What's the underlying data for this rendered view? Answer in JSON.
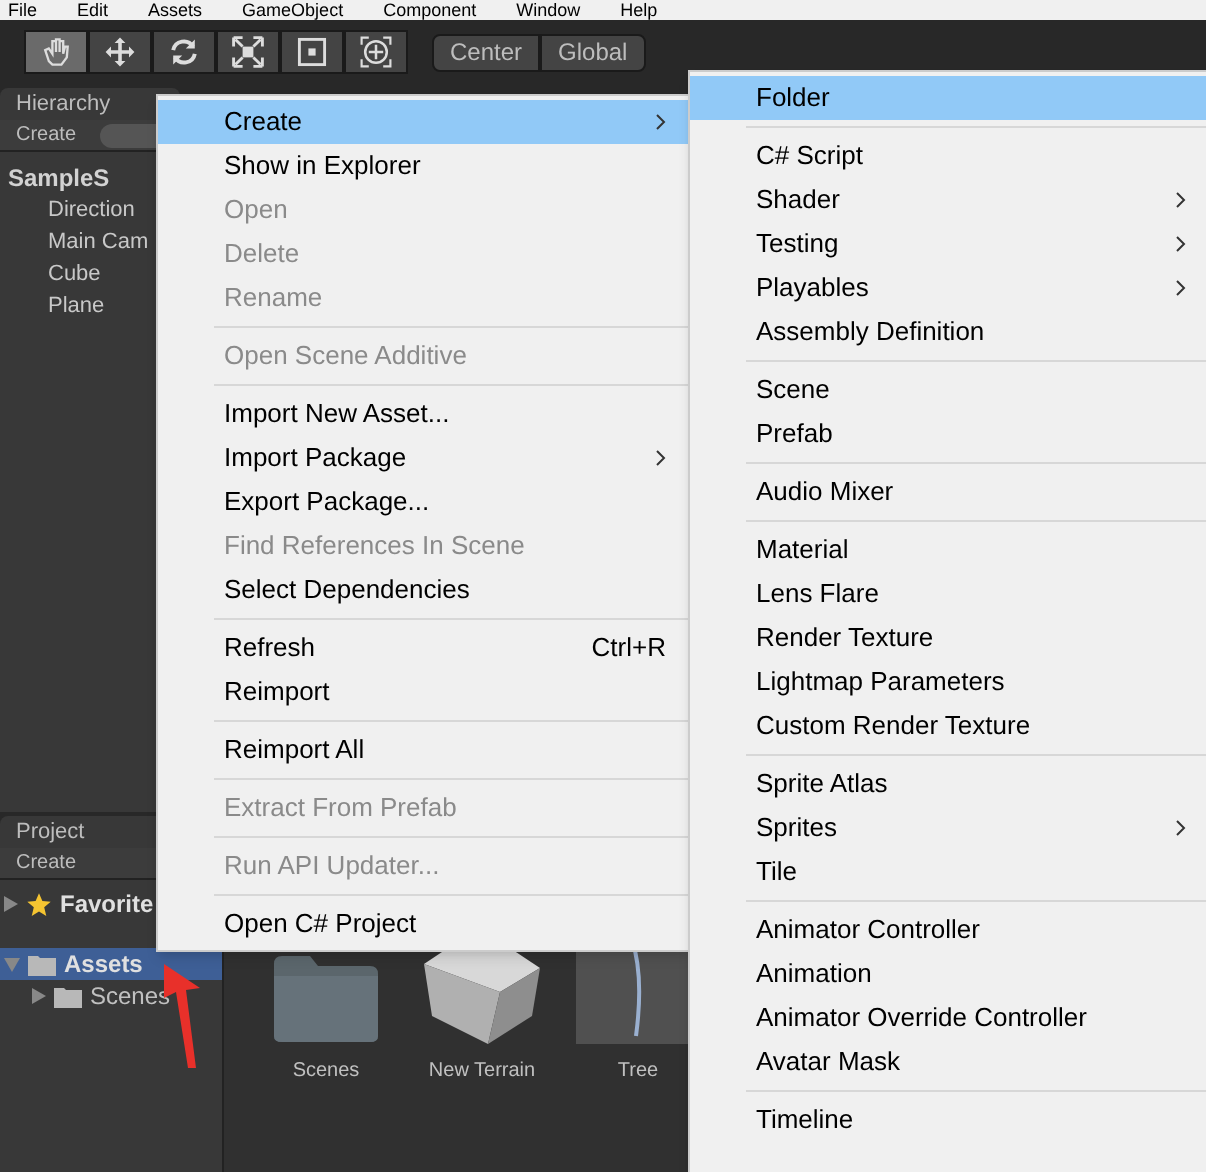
{
  "menu_bar": [
    "File",
    "Edit",
    "Assets",
    "GameObject",
    "Component",
    "Window",
    "Help"
  ],
  "toolbar": {
    "tools": [
      {
        "kind": "hand",
        "selected": true
      },
      {
        "kind": "move",
        "selected": false
      },
      {
        "kind": "rotate",
        "selected": false
      },
      {
        "kind": "scale",
        "selected": false
      },
      {
        "kind": "rect",
        "selected": false
      },
      {
        "kind": "transform",
        "selected": false
      }
    ],
    "pivot": "Center",
    "space": "Global"
  },
  "hierarchy": {
    "tab": "Hierarchy",
    "create": "Create",
    "scene": "SampleS",
    "items": [
      "Direction",
      "Main Cam",
      "Cube",
      "Plane"
    ]
  },
  "project": {
    "tab": "Project",
    "create": "Create",
    "tree": [
      {
        "label": "Favorite",
        "kind": "favorites",
        "selected": false,
        "expanded": false
      },
      {
        "label": "Assets",
        "kind": "folder",
        "selected": true,
        "expanded": true,
        "children": [
          {
            "label": "Scenes",
            "kind": "folder",
            "selected": false,
            "expanded": false
          }
        ]
      }
    ],
    "assets": [
      {
        "label": "Scenes",
        "kind": "folder"
      },
      {
        "label": "New Terrain",
        "kind": "terrain"
      },
      {
        "label": "Tree",
        "kind": "tree"
      }
    ]
  },
  "context_menu": [
    {
      "kind": "item",
      "label": "Create",
      "selected": true,
      "disabled": false,
      "submenu": true
    },
    {
      "kind": "item",
      "label": "Show in Explorer",
      "selected": false,
      "disabled": false,
      "submenu": false
    },
    {
      "kind": "item",
      "label": "Open",
      "selected": false,
      "disabled": true,
      "submenu": false
    },
    {
      "kind": "item",
      "label": "Delete",
      "selected": false,
      "disabled": true,
      "submenu": false
    },
    {
      "kind": "item",
      "label": "Rename",
      "selected": false,
      "disabled": true,
      "submenu": false
    },
    {
      "kind": "separator"
    },
    {
      "kind": "item",
      "label": "Open Scene Additive",
      "selected": false,
      "disabled": true,
      "submenu": false
    },
    {
      "kind": "separator"
    },
    {
      "kind": "item",
      "label": "Import New Asset...",
      "selected": false,
      "disabled": false,
      "submenu": false
    },
    {
      "kind": "item",
      "label": "Import Package",
      "selected": false,
      "disabled": false,
      "submenu": true
    },
    {
      "kind": "item",
      "label": "Export Package...",
      "selected": false,
      "disabled": false,
      "submenu": false
    },
    {
      "kind": "item",
      "label": "Find References In Scene",
      "selected": false,
      "disabled": true,
      "submenu": false
    },
    {
      "kind": "item",
      "label": "Select Dependencies",
      "selected": false,
      "disabled": false,
      "submenu": false
    },
    {
      "kind": "separator"
    },
    {
      "kind": "item",
      "label": "Refresh",
      "shortcut": "Ctrl+R",
      "selected": false,
      "disabled": false,
      "submenu": false
    },
    {
      "kind": "item",
      "label": "Reimport",
      "selected": false,
      "disabled": false,
      "submenu": false
    },
    {
      "kind": "separator"
    },
    {
      "kind": "item",
      "label": "Reimport All",
      "selected": false,
      "disabled": false,
      "submenu": false
    },
    {
      "kind": "separator"
    },
    {
      "kind": "item",
      "label": "Extract From Prefab",
      "selected": false,
      "disabled": true,
      "submenu": false
    },
    {
      "kind": "separator"
    },
    {
      "kind": "item",
      "label": "Run API Updater...",
      "selected": false,
      "disabled": true,
      "submenu": false
    },
    {
      "kind": "separator"
    },
    {
      "kind": "item",
      "label": "Open C# Project",
      "selected": false,
      "disabled": false,
      "submenu": false
    }
  ],
  "create_submenu": [
    {
      "kind": "item",
      "label": "Folder",
      "selected": true,
      "disabled": false,
      "submenu": false
    },
    {
      "kind": "separator"
    },
    {
      "kind": "item",
      "label": "C# Script",
      "selected": false,
      "disabled": false,
      "submenu": false
    },
    {
      "kind": "item",
      "label": "Shader",
      "selected": false,
      "disabled": false,
      "submenu": true
    },
    {
      "kind": "item",
      "label": "Testing",
      "selected": false,
      "disabled": false,
      "submenu": true
    },
    {
      "kind": "item",
      "label": "Playables",
      "selected": false,
      "disabled": false,
      "submenu": true
    },
    {
      "kind": "item",
      "label": "Assembly Definition",
      "selected": false,
      "disabled": false,
      "submenu": false
    },
    {
      "kind": "separator"
    },
    {
      "kind": "item",
      "label": "Scene",
      "selected": false,
      "disabled": false,
      "submenu": false
    },
    {
      "kind": "item",
      "label": "Prefab",
      "selected": false,
      "disabled": false,
      "submenu": false
    },
    {
      "kind": "separator"
    },
    {
      "kind": "item",
      "label": "Audio Mixer",
      "selected": false,
      "disabled": false,
      "submenu": false
    },
    {
      "kind": "separator"
    },
    {
      "kind": "item",
      "label": "Material",
      "selected": false,
      "disabled": false,
      "submenu": false
    },
    {
      "kind": "item",
      "label": "Lens Flare",
      "selected": false,
      "disabled": false,
      "submenu": false
    },
    {
      "kind": "item",
      "label": "Render Texture",
      "selected": false,
      "disabled": false,
      "submenu": false
    },
    {
      "kind": "item",
      "label": "Lightmap Parameters",
      "selected": false,
      "disabled": false,
      "submenu": false
    },
    {
      "kind": "item",
      "label": "Custom Render Texture",
      "selected": false,
      "disabled": false,
      "submenu": false
    },
    {
      "kind": "separator"
    },
    {
      "kind": "item",
      "label": "Sprite Atlas",
      "selected": false,
      "disabled": false,
      "submenu": false
    },
    {
      "kind": "item",
      "label": "Sprites",
      "selected": false,
      "disabled": false,
      "submenu": true
    },
    {
      "kind": "item",
      "label": "Tile",
      "selected": false,
      "disabled": false,
      "submenu": false
    },
    {
      "kind": "separator"
    },
    {
      "kind": "item",
      "label": "Animator Controller",
      "selected": false,
      "disabled": false,
      "submenu": false
    },
    {
      "kind": "item",
      "label": "Animation",
      "selected": false,
      "disabled": false,
      "submenu": false
    },
    {
      "kind": "item",
      "label": "Animator Override Controller",
      "selected": false,
      "disabled": false,
      "submenu": false
    },
    {
      "kind": "item",
      "label": "Avatar Mask",
      "selected": false,
      "disabled": false,
      "submenu": false
    },
    {
      "kind": "separator"
    },
    {
      "kind": "item",
      "label": "Timeline",
      "selected": false,
      "disabled": false,
      "submenu": false
    }
  ]
}
